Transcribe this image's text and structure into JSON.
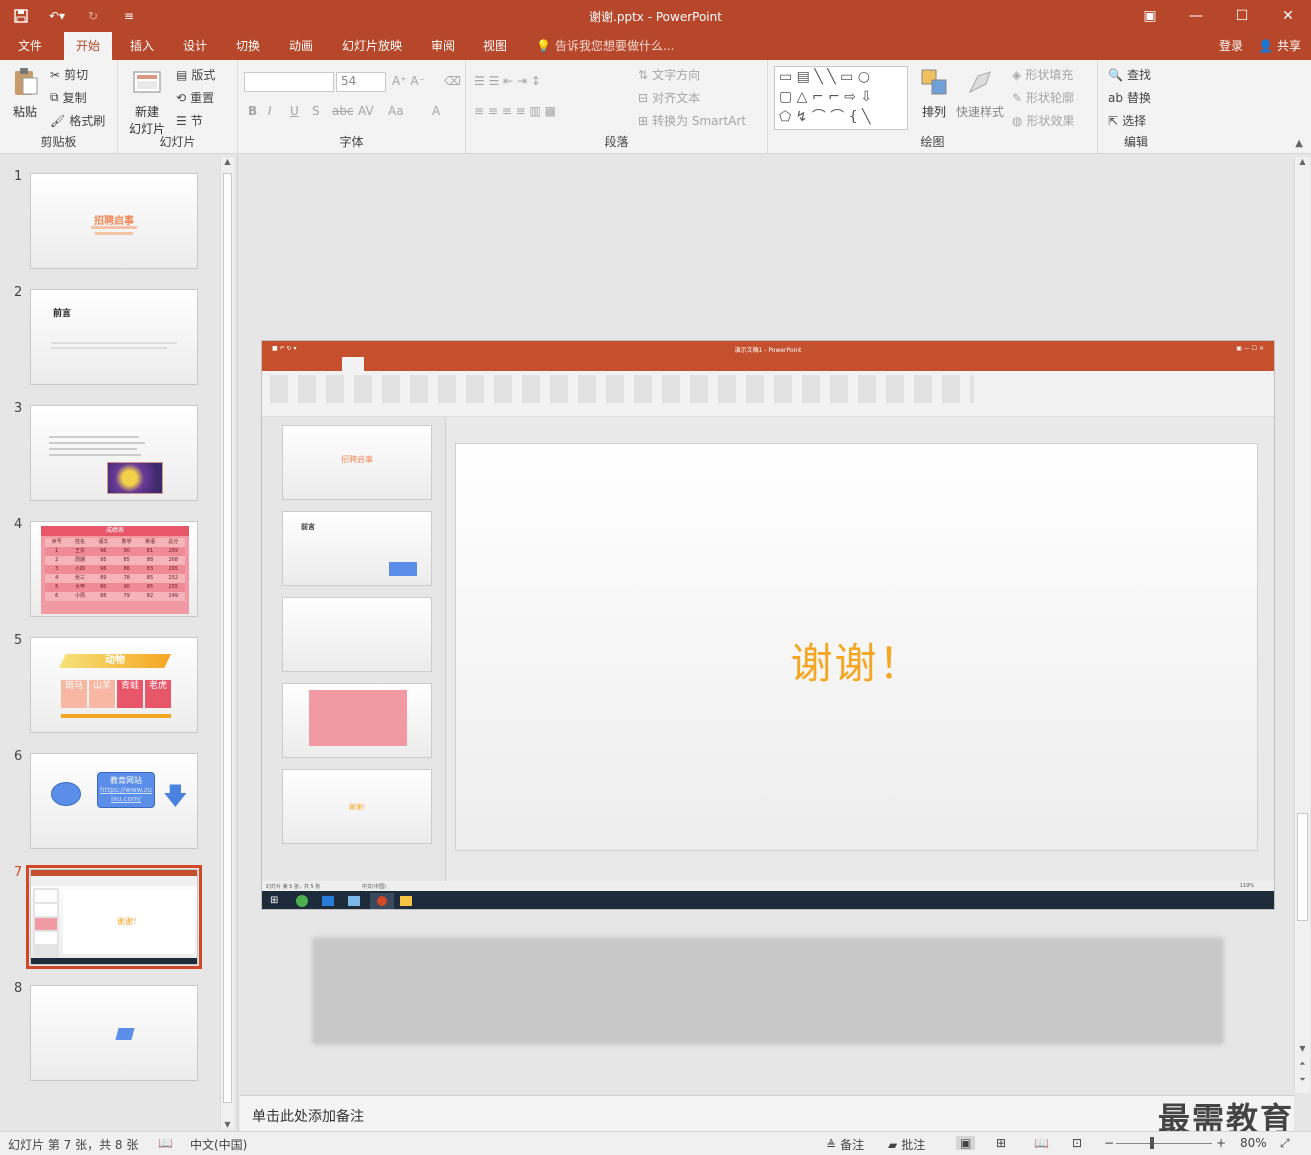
{
  "window": {
    "title": "谢谢.pptx - PowerPoint"
  },
  "tabs": [
    "文件",
    "开始",
    "插入",
    "设计",
    "切换",
    "动画",
    "幻灯片放映",
    "审阅",
    "视图"
  ],
  "tell_me": "告诉我您想要做什么...",
  "account": {
    "login": "登录",
    "share": "共享"
  },
  "ribbon": {
    "clipboard": {
      "paste": "粘贴",
      "cut": "剪切",
      "copy": "复制",
      "format_painter": "格式刷",
      "label": "剪贴板"
    },
    "slides": {
      "new_slide": "新建",
      "new_slide2": "幻灯片",
      "layout": "版式",
      "reset": "重置",
      "section": "节",
      "label": "幻灯片"
    },
    "font": {
      "size": "54",
      "label": "字体"
    },
    "paragraph": {
      "text_direction": "文字方向",
      "align_text": "对齐文本",
      "smartart": "转换为 SmartArt",
      "label": "段落"
    },
    "drawing": {
      "arrange": "排列",
      "quick_styles": "快速样式",
      "shape_fill": "形状填充",
      "shape_outline": "形状轮廓",
      "shape_effects": "形状效果",
      "label": "绘图"
    },
    "editing": {
      "find": "查找",
      "replace": "替换",
      "select": "选择",
      "label": "编辑"
    }
  },
  "slides": [
    {
      "num": "1",
      "title": "招聘启事"
    },
    {
      "num": "2",
      "title": "前言"
    },
    {
      "num": "3",
      "title": ""
    },
    {
      "num": "4",
      "title": "成绩表"
    },
    {
      "num": "5",
      "title": "动物",
      "tiles": [
        "斑马",
        "山羊",
        "青蛙",
        "老虎"
      ]
    },
    {
      "num": "6",
      "title": "教育网站",
      "link": "https://www.zuixu.com/"
    },
    {
      "num": "7",
      "title": "谢谢！"
    },
    {
      "num": "8",
      "title": ""
    }
  ],
  "table4": {
    "headers": [
      "序号",
      "姓名",
      "语文",
      "数学",
      "英语",
      "总分"
    ],
    "rows": [
      [
        "1",
        "王东",
        "96",
        "90",
        "81",
        "269"
      ],
      [
        "2",
        "周期",
        "95",
        "85",
        "88",
        "268"
      ],
      [
        "3",
        "小四",
        "96",
        "86",
        "83",
        "265"
      ],
      [
        "4",
        "张三",
        "89",
        "78",
        "85",
        "252"
      ],
      [
        "5",
        "大甲",
        "80",
        "90",
        "85",
        "255"
      ],
      [
        "6",
        "小周",
        "88",
        "79",
        "82",
        "249"
      ]
    ]
  },
  "embedded": {
    "title": "演示文稿1 - PowerPoint",
    "slide_text": "谢谢！",
    "thumb1": "招聘启事",
    "thumb2": "前言",
    "thumb5": "谢谢!",
    "status": "幻灯片 第 5 张，共 5 张",
    "lang": "中文(中国)",
    "zoom": "119%"
  },
  "notes_placeholder": "单击此处添加备注",
  "status": {
    "slide_info": "幻灯片 第 7 张，共 8 张",
    "language": "中文(中国)",
    "notes": "备注",
    "comments": "批注",
    "zoom": "80%"
  },
  "watermark": "最需教育",
  "colors": {
    "accent": "#b7472a",
    "thanks": "#f5a623",
    "table": "#f08a95"
  }
}
